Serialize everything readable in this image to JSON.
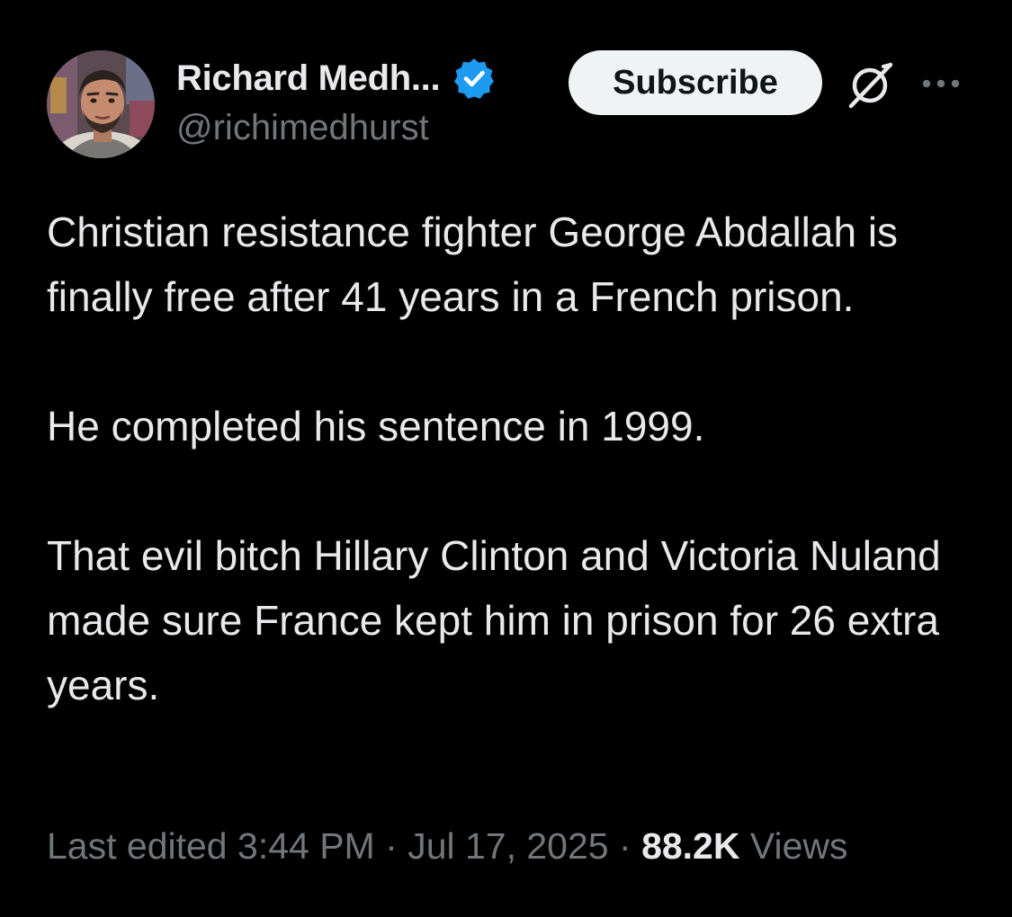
{
  "author": {
    "display_name": "Richard Medh...",
    "handle": "@richimedhurst",
    "verified": true,
    "verified_color": "#1d9bf0"
  },
  "actions": {
    "subscribe_label": "Subscribe",
    "grok_icon": "grok-icon",
    "more_icon": "more-horizontal-icon"
  },
  "tweet": {
    "paragraphs": [
      "Christian resistance fighter George Abdallah is finally free after 41 years in a French prison.",
      "He completed his sentence in 1999.",
      "That evil bitch Hillary Clinton and Victoria Nuland made sure France kept him in prison for 26 extra years."
    ]
  },
  "meta": {
    "edited_label": "Last edited",
    "time": "3:44 PM",
    "date": "Jul 17, 2025",
    "separator": "·",
    "views_count": "88.2K",
    "views_label": "Views"
  },
  "colors": {
    "background": "#000000",
    "text_primary": "#e7e9ea",
    "text_secondary": "#71767b",
    "button_bg": "#eff3f4",
    "button_text": "#0f1419"
  }
}
